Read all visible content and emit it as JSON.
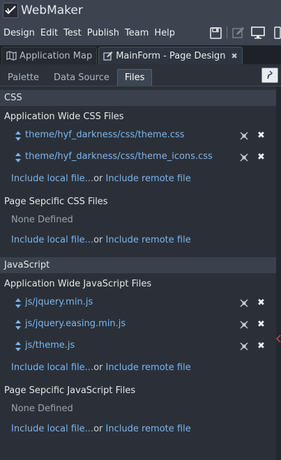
{
  "app": {
    "title": "WebMaker"
  },
  "menu": {
    "items": [
      "Design",
      "Edit",
      "Test",
      "Publish",
      "Team",
      "Help"
    ],
    "icons": [
      "save-icon",
      "edit-icon",
      "monitor-icon",
      "mobile-icon"
    ]
  },
  "doc_tabs": [
    {
      "label": "Application Map",
      "icon": "map-icon",
      "active": false
    },
    {
      "label": "MainForm - Page Design",
      "icon": "edit-icon",
      "active": true,
      "close": "✖"
    }
  ],
  "sub_tabs": [
    {
      "label": "Palette",
      "active": false
    },
    {
      "label": "Data Source",
      "active": false
    },
    {
      "label": "Files",
      "active": true
    }
  ],
  "css_section": {
    "header": "CSS",
    "app_wide_title": "Application Wide CSS Files",
    "app_wide_files": [
      "theme/hyf_darkness/css/theme.css",
      "theme/hyf_darkness/css/theme_icons.css"
    ],
    "app_include_local": "Include local file...",
    "app_or": "or",
    "app_include_remote": "Include remote file",
    "page_title": "Page Sepcific CSS Files",
    "page_none": "None Defined",
    "page_include_local": "Include local file...",
    "page_or": "or",
    "page_include_remote": "Include remote file"
  },
  "js_section": {
    "header": "JavaScript",
    "app_wide_title": "Application Wide JavaScript Files",
    "app_wide_files": [
      "js/jquery.min.js",
      "js/jquery.easing.min.js",
      "js/theme.js"
    ],
    "app_include_local": "Include local file...",
    "app_or": "or",
    "app_include_remote": "Include remote file",
    "page_title": "Page Sepcific JavaScript Files",
    "page_none": "None Defined",
    "page_include_local": "Include local file...",
    "page_or": "or",
    "page_include_remote": "Include remote file"
  },
  "colors": {
    "background": "#2b3038",
    "bar": "#3d4450",
    "link": "#79b6f0",
    "section_header": "#3a414c"
  }
}
